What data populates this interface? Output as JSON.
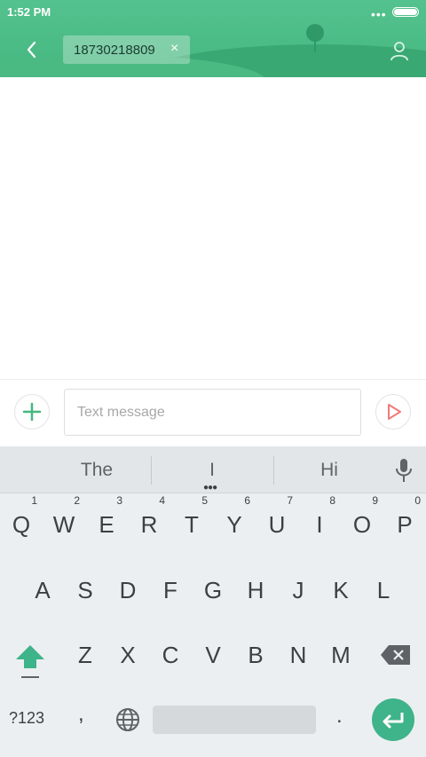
{
  "status_bar": {
    "time": "1:52 PM",
    "dots": "•••"
  },
  "recipient": {
    "number": "18730218809",
    "remove": "×"
  },
  "compose": {
    "placeholder": "Text message"
  },
  "keyboard": {
    "suggestions": [
      "The",
      "I",
      "Hi"
    ],
    "row1": [
      {
        "key": "Q",
        "hint": "1"
      },
      {
        "key": "W",
        "hint": "2"
      },
      {
        "key": "E",
        "hint": "3"
      },
      {
        "key": "R",
        "hint": "4"
      },
      {
        "key": "T",
        "hint": "5"
      },
      {
        "key": "Y",
        "hint": "6"
      },
      {
        "key": "U",
        "hint": "7"
      },
      {
        "key": "I",
        "hint": "8"
      },
      {
        "key": "O",
        "hint": "9"
      },
      {
        "key": "P",
        "hint": "0"
      }
    ],
    "row2": [
      "A",
      "S",
      "D",
      "F",
      "G",
      "H",
      "J",
      "K",
      "L"
    ],
    "row3": [
      "Z",
      "X",
      "C",
      "V",
      "B",
      "N",
      "M"
    ],
    "bottom": {
      "symbols": "?123",
      "comma": ",",
      "period": "."
    }
  },
  "colors": {
    "accent": "#45b77f",
    "send": "#f07a7a",
    "enter": "#3fb38a"
  },
  "icons": [
    "back-arrow-icon",
    "close-icon",
    "contact-icon",
    "plus-icon",
    "send-icon",
    "mic-icon",
    "shift-icon",
    "backspace-icon",
    "globe-icon",
    "enter-icon"
  ]
}
